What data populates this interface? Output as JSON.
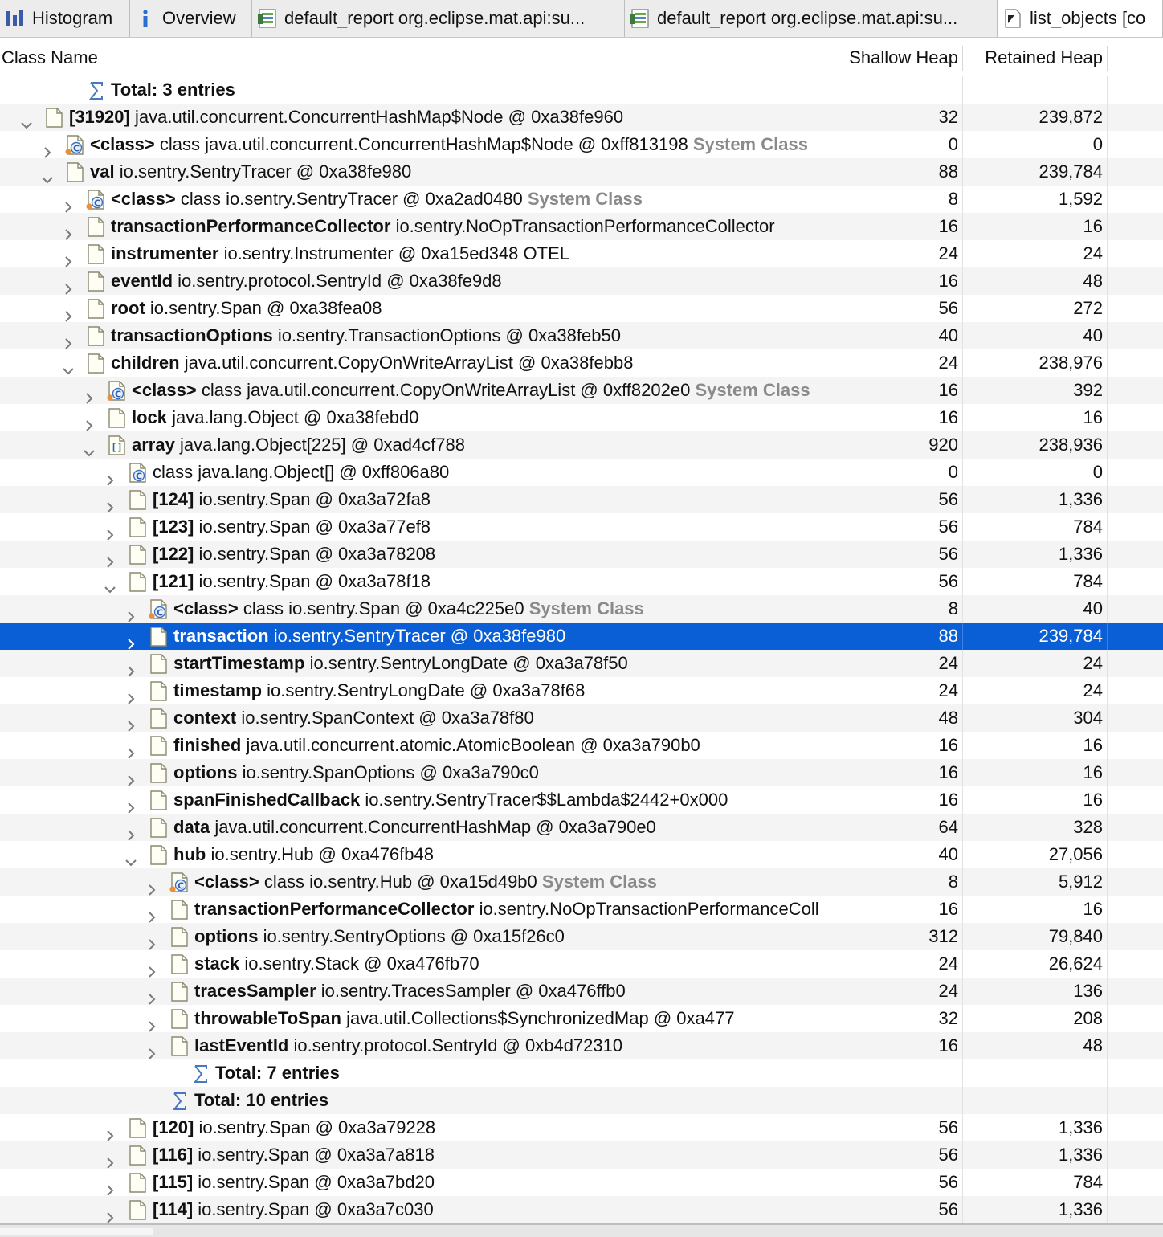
{
  "tabs": [
    {
      "label": "Histogram",
      "icon": "histogram-icon",
      "active": false
    },
    {
      "label": "Overview",
      "icon": "info-icon",
      "active": false
    },
    {
      "label": "default_report org.eclipse.mat.api:su...",
      "icon": "report-icon",
      "active": false
    },
    {
      "label": "default_report org.eclipse.mat.api:su...",
      "icon": "report-icon",
      "active": false
    },
    {
      "label": "list_objects [co",
      "icon": "list-objects-icon",
      "active": true
    }
  ],
  "columns": {
    "name": "Class Name",
    "shallow": "Shallow Heap",
    "retained": "Retained Heap"
  },
  "colors": {
    "selection": "#0a5fd6",
    "system_class": "#8a8a8a",
    "alt_row": "#f4f4f4"
  },
  "rows": [
    {
      "depth": 5,
      "tw": "none",
      "icon": "sum",
      "bold": "Total: 3 entries",
      "rest": "",
      "sys": "",
      "shallow": "",
      "retained": ""
    },
    {
      "depth": 3,
      "tw": "open",
      "icon": "obj",
      "bold": "[31920]",
      "rest": "java.util.concurrent.ConcurrentHashMap$Node @ 0xa38fe960",
      "sys": "",
      "shallow": "32",
      "retained": "239,872"
    },
    {
      "depth": 4,
      "tw": "closed",
      "icon": "cls",
      "bold": "<class>",
      "rest": "class java.util.concurrent.ConcurrentHashMap$Node @ 0xff813198",
      "sys": "System Class",
      "shallow": "0",
      "retained": "0"
    },
    {
      "depth": 4,
      "tw": "open",
      "icon": "obj",
      "bold": "val",
      "rest": "io.sentry.SentryTracer @ 0xa38fe980",
      "sys": "",
      "shallow": "88",
      "retained": "239,784"
    },
    {
      "depth": 5,
      "tw": "closed",
      "icon": "cls",
      "bold": "<class>",
      "rest": "class io.sentry.SentryTracer @ 0xa2ad0480",
      "sys": "System Class",
      "shallow": "8",
      "retained": "1,592"
    },
    {
      "depth": 5,
      "tw": "closed",
      "icon": "obj",
      "bold": "transactionPerformanceCollector",
      "rest": "io.sentry.NoOpTransactionPerformanceCollector",
      "sys": "",
      "shallow": "16",
      "retained": "16"
    },
    {
      "depth": 5,
      "tw": "closed",
      "icon": "obj",
      "bold": "instrumenter",
      "rest": "io.sentry.Instrumenter @ 0xa15ed348  OTEL",
      "sys": "",
      "shallow": "24",
      "retained": "24"
    },
    {
      "depth": 5,
      "tw": "closed",
      "icon": "obj",
      "bold": "eventId",
      "rest": "io.sentry.protocol.SentryId @ 0xa38fe9d8",
      "sys": "",
      "shallow": "16",
      "retained": "48"
    },
    {
      "depth": 5,
      "tw": "closed",
      "icon": "obj",
      "bold": "root",
      "rest": "io.sentry.Span @ 0xa38fea08",
      "sys": "",
      "shallow": "56",
      "retained": "272"
    },
    {
      "depth": 5,
      "tw": "closed",
      "icon": "obj",
      "bold": "transactionOptions",
      "rest": "io.sentry.TransactionOptions @ 0xa38feb50",
      "sys": "",
      "shallow": "40",
      "retained": "40"
    },
    {
      "depth": 5,
      "tw": "open",
      "icon": "obj",
      "bold": "children",
      "rest": "java.util.concurrent.CopyOnWriteArrayList @ 0xa38febb8",
      "sys": "",
      "shallow": "24",
      "retained": "238,976"
    },
    {
      "depth": 6,
      "tw": "closed",
      "icon": "cls",
      "bold": "<class>",
      "rest": "class java.util.concurrent.CopyOnWriteArrayList @ 0xff8202e0",
      "sys": "System Class",
      "shallow": "16",
      "retained": "392"
    },
    {
      "depth": 6,
      "tw": "closed",
      "icon": "obj",
      "bold": "lock",
      "rest": "java.lang.Object @ 0xa38febd0",
      "sys": "",
      "shallow": "16",
      "retained": "16"
    },
    {
      "depth": 6,
      "tw": "open",
      "icon": "arr",
      "bold": "array",
      "rest": "java.lang.Object[225] @ 0xad4cf788",
      "sys": "",
      "shallow": "920",
      "retained": "238,936"
    },
    {
      "depth": 7,
      "tw": "closed",
      "icon": "clsplain",
      "bold": "",
      "rest": "class java.lang.Object[] @ 0xff806a80",
      "sys": "",
      "shallow": "0",
      "retained": "0"
    },
    {
      "depth": 7,
      "tw": "closed",
      "icon": "obj",
      "bold": "[124]",
      "rest": "io.sentry.Span @ 0xa3a72fa8",
      "sys": "",
      "shallow": "56",
      "retained": "1,336"
    },
    {
      "depth": 7,
      "tw": "closed",
      "icon": "obj",
      "bold": "[123]",
      "rest": "io.sentry.Span @ 0xa3a77ef8",
      "sys": "",
      "shallow": "56",
      "retained": "784"
    },
    {
      "depth": 7,
      "tw": "closed",
      "icon": "obj",
      "bold": "[122]",
      "rest": "io.sentry.Span @ 0xa3a78208",
      "sys": "",
      "shallow": "56",
      "retained": "1,336"
    },
    {
      "depth": 7,
      "tw": "open",
      "icon": "obj",
      "bold": "[121]",
      "rest": "io.sentry.Span @ 0xa3a78f18",
      "sys": "",
      "shallow": "56",
      "retained": "784"
    },
    {
      "depth": 8,
      "tw": "closed",
      "icon": "cls",
      "bold": "<class>",
      "rest": "class io.sentry.Span @ 0xa4c225e0",
      "sys": "System Class",
      "shallow": "8",
      "retained": "40"
    },
    {
      "depth": 8,
      "tw": "closed",
      "icon": "obj",
      "bold": "transaction",
      "rest": "io.sentry.SentryTracer @ 0xa38fe980",
      "sys": "",
      "shallow": "88",
      "retained": "239,784",
      "selected": true
    },
    {
      "depth": 8,
      "tw": "closed",
      "icon": "obj",
      "bold": "startTimestamp",
      "rest": "io.sentry.SentryLongDate @ 0xa3a78f50",
      "sys": "",
      "shallow": "24",
      "retained": "24"
    },
    {
      "depth": 8,
      "tw": "closed",
      "icon": "obj",
      "bold": "timestamp",
      "rest": "io.sentry.SentryLongDate @ 0xa3a78f68",
      "sys": "",
      "shallow": "24",
      "retained": "24"
    },
    {
      "depth": 8,
      "tw": "closed",
      "icon": "obj",
      "bold": "context",
      "rest": "io.sentry.SpanContext @ 0xa3a78f80",
      "sys": "",
      "shallow": "48",
      "retained": "304"
    },
    {
      "depth": 8,
      "tw": "closed",
      "icon": "obj",
      "bold": "finished",
      "rest": "java.util.concurrent.atomic.AtomicBoolean @ 0xa3a790b0",
      "sys": "",
      "shallow": "16",
      "retained": "16"
    },
    {
      "depth": 8,
      "tw": "closed",
      "icon": "obj",
      "bold": "options",
      "rest": "io.sentry.SpanOptions @ 0xa3a790c0",
      "sys": "",
      "shallow": "16",
      "retained": "16"
    },
    {
      "depth": 8,
      "tw": "closed",
      "icon": "obj",
      "bold": "spanFinishedCallback",
      "rest": "io.sentry.SentryTracer$$Lambda$2442+0x000",
      "sys": "",
      "shallow": "16",
      "retained": "16"
    },
    {
      "depth": 8,
      "tw": "closed",
      "icon": "obj",
      "bold": "data",
      "rest": "java.util.concurrent.ConcurrentHashMap @ 0xa3a790e0",
      "sys": "",
      "shallow": "64",
      "retained": "328"
    },
    {
      "depth": 8,
      "tw": "open",
      "icon": "obj",
      "bold": "hub",
      "rest": "io.sentry.Hub @ 0xa476fb48",
      "sys": "",
      "shallow": "40",
      "retained": "27,056"
    },
    {
      "depth": 9,
      "tw": "closed",
      "icon": "cls",
      "bold": "<class>",
      "rest": "class io.sentry.Hub @ 0xa15d49b0",
      "sys": "System Class",
      "shallow": "8",
      "retained": "5,912"
    },
    {
      "depth": 9,
      "tw": "closed",
      "icon": "obj",
      "bold": "transactionPerformanceCollector",
      "rest": "io.sentry.NoOpTransactionPerformanceCollector",
      "sys": "",
      "shallow": "16",
      "retained": "16"
    },
    {
      "depth": 9,
      "tw": "closed",
      "icon": "obj",
      "bold": "options",
      "rest": "io.sentry.SentryOptions @ 0xa15f26c0",
      "sys": "",
      "shallow": "312",
      "retained": "79,840"
    },
    {
      "depth": 9,
      "tw": "closed",
      "icon": "obj",
      "bold": "stack",
      "rest": "io.sentry.Stack @ 0xa476fb70",
      "sys": "",
      "shallow": "24",
      "retained": "26,624"
    },
    {
      "depth": 9,
      "tw": "closed",
      "icon": "obj",
      "bold": "tracesSampler",
      "rest": "io.sentry.TracesSampler @ 0xa476ffb0",
      "sys": "",
      "shallow": "24",
      "retained": "136"
    },
    {
      "depth": 9,
      "tw": "closed",
      "icon": "obj",
      "bold": "throwableToSpan",
      "rest": "java.util.Collections$SynchronizedMap @ 0xa477",
      "sys": "",
      "shallow": "32",
      "retained": "208"
    },
    {
      "depth": 9,
      "tw": "closed",
      "icon": "obj",
      "bold": "lastEventId",
      "rest": "io.sentry.protocol.SentryId @ 0xb4d72310",
      "sys": "",
      "shallow": "16",
      "retained": "48"
    },
    {
      "depth": 10,
      "tw": "none",
      "icon": "sum",
      "bold": "Total: 7 entries",
      "rest": "",
      "sys": "",
      "shallow": "",
      "retained": ""
    },
    {
      "depth": 9,
      "tw": "none",
      "icon": "sum",
      "bold": "Total: 10 entries",
      "rest": "",
      "sys": "",
      "shallow": "",
      "retained": ""
    },
    {
      "depth": 7,
      "tw": "closed",
      "icon": "obj",
      "bold": "[120]",
      "rest": "io.sentry.Span @ 0xa3a79228",
      "sys": "",
      "shallow": "56",
      "retained": "1,336"
    },
    {
      "depth": 7,
      "tw": "closed",
      "icon": "obj",
      "bold": "[116]",
      "rest": "io.sentry.Span @ 0xa3a7a818",
      "sys": "",
      "shallow": "56",
      "retained": "1,336"
    },
    {
      "depth": 7,
      "tw": "closed",
      "icon": "obj",
      "bold": "[115]",
      "rest": "io.sentry.Span @ 0xa3a7bd20",
      "sys": "",
      "shallow": "56",
      "retained": "784"
    },
    {
      "depth": 7,
      "tw": "closed",
      "icon": "obj",
      "bold": "[114]",
      "rest": "io.sentry.Span @ 0xa3a7c030",
      "sys": "",
      "shallow": "56",
      "retained": "1,336"
    }
  ]
}
